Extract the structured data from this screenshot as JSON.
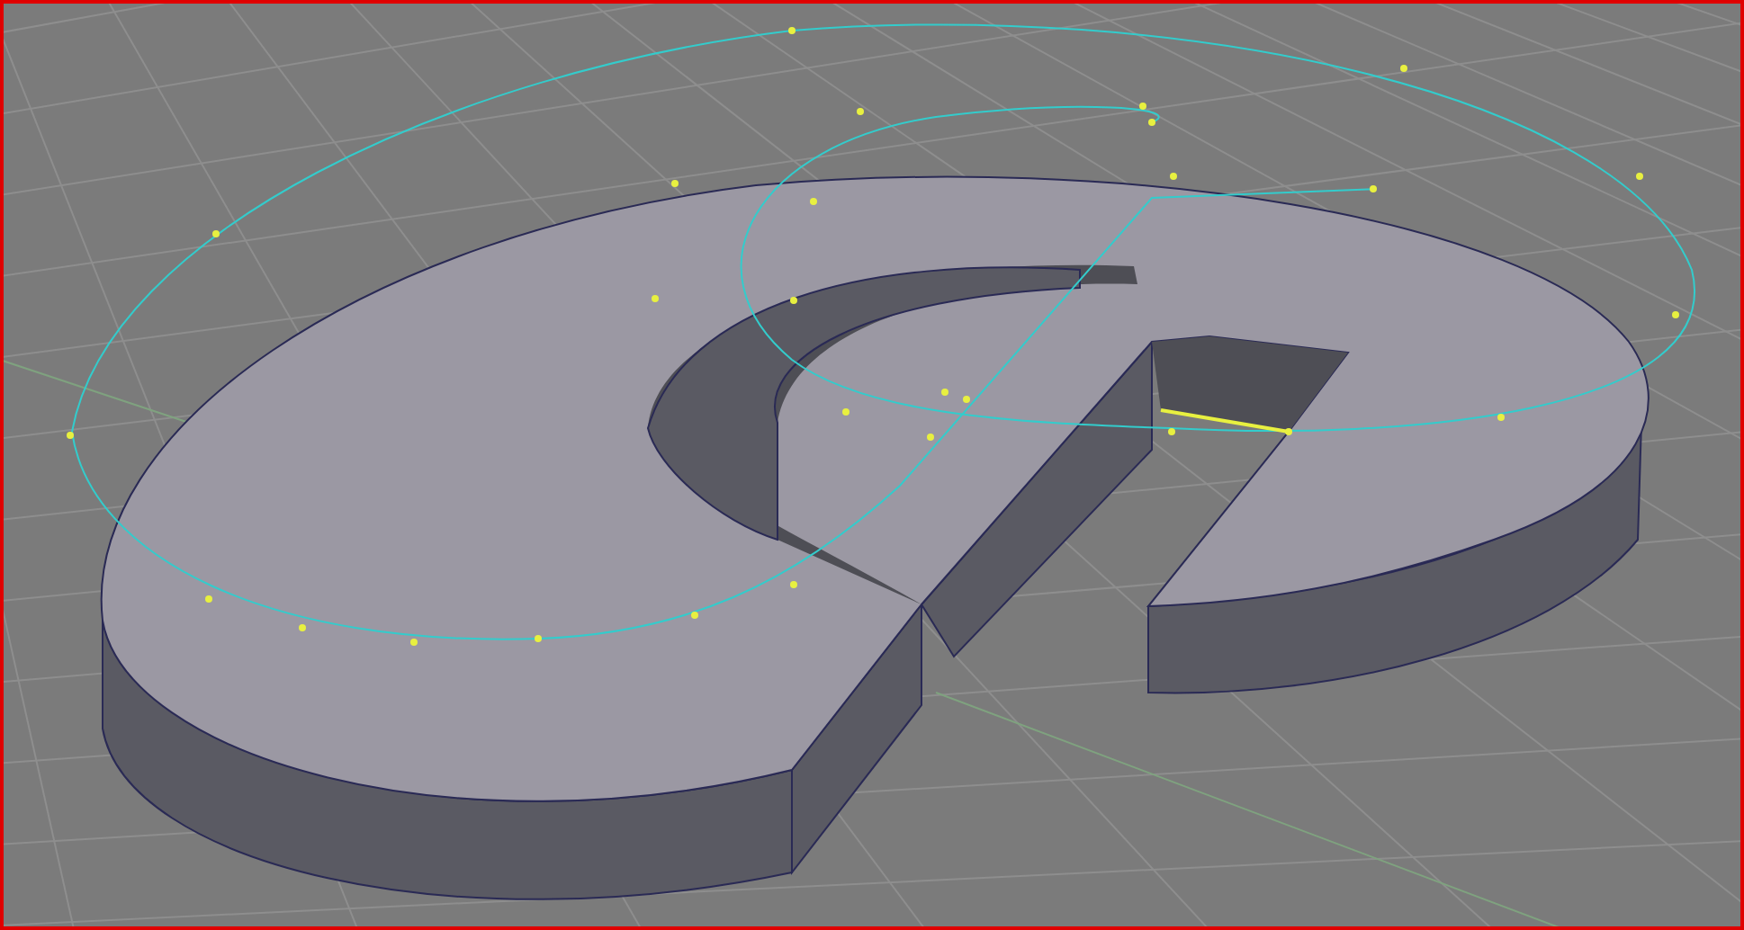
{
  "viewport": {
    "active": true
  }
}
